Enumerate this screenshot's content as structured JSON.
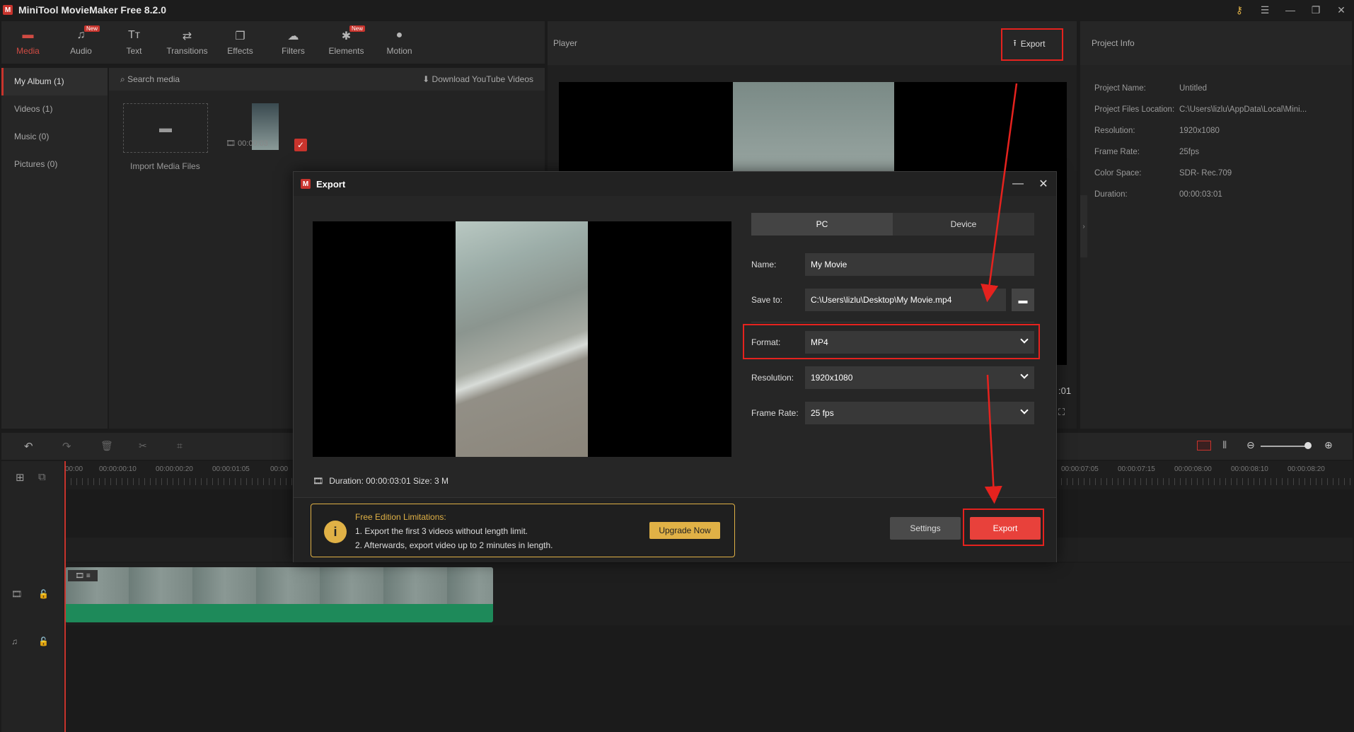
{
  "app": {
    "title": "MiniTool MovieMaker Free 8.2.0"
  },
  "toolbar": [
    {
      "label": "Media",
      "icon": "folder-icon",
      "new": false
    },
    {
      "label": "Audio",
      "icon": "music-icon",
      "new": true
    },
    {
      "label": "Text",
      "icon": "text-icon",
      "new": false
    },
    {
      "label": "Transitions",
      "icon": "transitions-icon",
      "new": false
    },
    {
      "label": "Effects",
      "icon": "effects-icon",
      "new": false
    },
    {
      "label": "Filters",
      "icon": "filters-icon",
      "new": false
    },
    {
      "label": "Elements",
      "icon": "elements-icon",
      "new": true
    },
    {
      "label": "Motion",
      "icon": "motion-icon",
      "new": false
    }
  ],
  "new_tag": "New",
  "sidebar": [
    {
      "label": "My Album (1)"
    },
    {
      "label": "Videos (1)"
    },
    {
      "label": "Music (0)"
    },
    {
      "label": "Pictures (0)"
    }
  ],
  "media": {
    "search_placeholder": "Search media",
    "download_label": "Download YouTube Videos",
    "import_label": "Import Media Files",
    "clip_duration": "00:00:03"
  },
  "player": {
    "label": "Player",
    "export_label": "Export",
    "time_fragment": ":01"
  },
  "project_info": {
    "title": "Project Info",
    "rows": [
      {
        "k": "Project Name:",
        "v": "Untitled"
      },
      {
        "k": "Project Files Location:",
        "v": "C:\\Users\\lizlu\\AppData\\Local\\Mini..."
      },
      {
        "k": "Resolution:",
        "v": "1920x1080"
      },
      {
        "k": "Frame Rate:",
        "v": "25fps"
      },
      {
        "k": "Color Space:",
        "v": "SDR- Rec.709"
      },
      {
        "k": "Duration:",
        "v": "00:00:03:01"
      }
    ]
  },
  "ruler": {
    "left_ticks": [
      "00:00",
      "00:00:00:10",
      "00:00:00:20",
      "00:00:01:05",
      "00:00"
    ],
    "right_ticks": [
      "00:00:07:05",
      "00:00:07:15",
      "00:00:08:00",
      "00:00:08:10",
      "00:00:08:20"
    ]
  },
  "dialog": {
    "title": "Export",
    "tabs": [
      "PC",
      "Device"
    ],
    "name_label": "Name:",
    "name_value": "My Movie",
    "save_label": "Save to:",
    "save_value": "C:\\Users\\lizlu\\Desktop\\My Movie.mp4",
    "format_label": "Format:",
    "format_value": "MP4",
    "resolution_label": "Resolution:",
    "resolution_value": "1920x1080",
    "framerate_label": "Frame Rate:",
    "framerate_value": "25 fps",
    "duration_text": "Duration:  00:00:03:01  Size: 3 M",
    "limits": {
      "title": "Free Edition Limitations:",
      "line1": "1. Export the first 3 videos without length limit.",
      "line2": "2. Afterwards, export video up to 2 minutes in length.",
      "upgrade": "Upgrade Now"
    },
    "settings_label": "Settings",
    "export_label": "Export"
  },
  "colors": {
    "accent": "#c8342d",
    "highlight": "#e5221e",
    "gold": "#e0b146",
    "export_button": "#e8413b"
  }
}
